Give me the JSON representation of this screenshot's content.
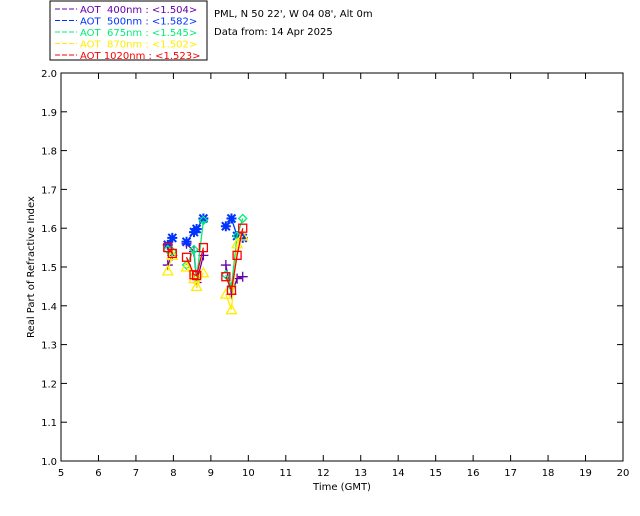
{
  "chart_data": {
    "type": "line",
    "header": {
      "site": "PML, N 50 22', W 04 08', Alt 0m",
      "date": "Data from: 14 Apr 2025"
    },
    "xlabel": "Time (GMT)",
    "ylabel": "Real Part of Refractive Index",
    "xlim": [
      5,
      20
    ],
    "ylim": [
      1.0,
      2.0
    ],
    "xticks": [
      5,
      6,
      7,
      8,
      9,
      10,
      11,
      12,
      13,
      14,
      15,
      16,
      17,
      18,
      19,
      20
    ],
    "yticks": [
      "1.0",
      "1.1",
      "1.2",
      "1.3",
      "1.4",
      "1.5",
      "1.6",
      "1.7",
      "1.8",
      "1.9",
      "2.0"
    ],
    "grid": false,
    "legend_placement": "top-left, outside",
    "x": [
      7.85,
      7.97,
      8.35,
      8.55,
      8.62,
      8.8,
      9.4,
      9.55,
      9.7,
      9.85
    ],
    "series": [
      {
        "name": "AOT  400nm : <1.504>",
        "color": "#6600aa",
        "marker": "plus",
        "values": [
          1.505,
          1.53,
          1.56,
          1.54,
          1.46,
          1.53,
          1.505,
          1.43,
          1.47,
          1.475
        ]
      },
      {
        "name": "AOT  500nm : <1.582>",
        "color": "#0033ff",
        "marker": "asterisk",
        "values": [
          1.557,
          1.575,
          1.565,
          1.59,
          1.598,
          1.625,
          1.605,
          1.625,
          1.58,
          1.575
        ]
      },
      {
        "name": "AOT  675nm : <1.545>",
        "color": "#00ee77",
        "marker": "diamond",
        "values": [
          1.545,
          1.54,
          1.505,
          1.545,
          1.47,
          1.62,
          1.48,
          1.45,
          1.58,
          1.625
        ]
      },
      {
        "name": "AOT  870nm : <1.502>",
        "color": "#ffee00",
        "marker": "triangle",
        "values": [
          1.49,
          1.53,
          1.5,
          1.47,
          1.45,
          1.485,
          1.43,
          1.39,
          1.56,
          1.58
        ]
      },
      {
        "name": "AOT 1020nm : <1.523>",
        "color": "#ff0000",
        "marker": "square",
        "values": [
          1.55,
          1.535,
          1.525,
          1.48,
          1.478,
          1.55,
          1.475,
          1.44,
          1.53,
          1.6
        ]
      }
    ]
  }
}
